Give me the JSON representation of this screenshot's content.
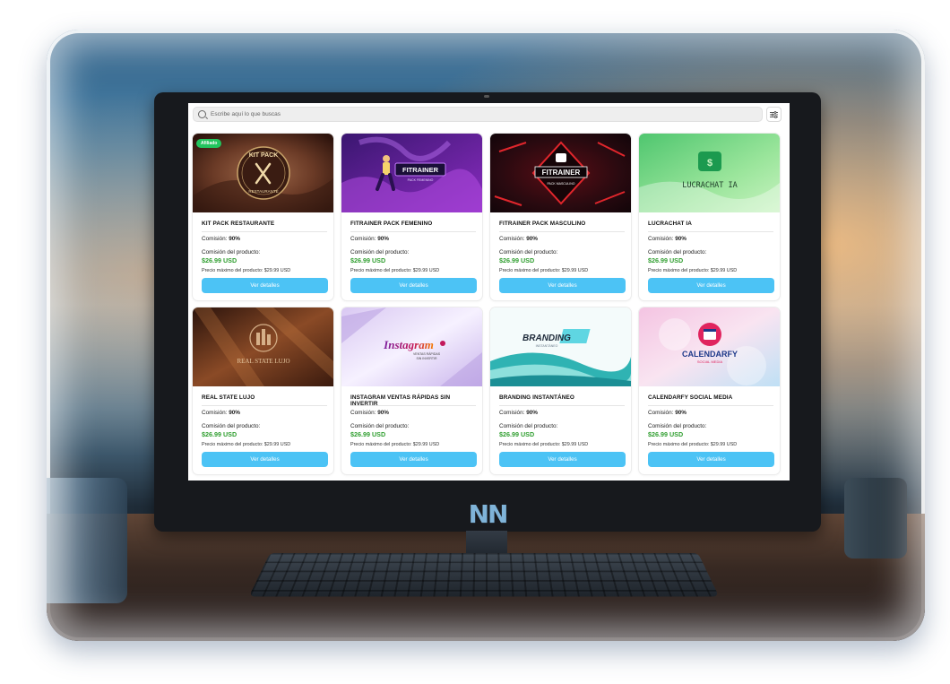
{
  "search": {
    "placeholder": "Escribe aquí lo que buscas"
  },
  "filter": {
    "icon": "sliders-icon"
  },
  "monitor": {
    "brand_logo": "NN"
  },
  "cards": [
    {
      "title": "KIT PACK RESTAURANTE",
      "badge": "Afiliado",
      "commission_label": "Comisión:",
      "commission": "90%",
      "price_label": "Comisión del producto:",
      "price": "$26.99 USD",
      "max_price": "Precio máximo del producto: $29.99 USD",
      "button": "Ver detalles",
      "thumb_lines": [
        "KIT PACK",
        "RESTAURANTE"
      ]
    },
    {
      "title": "FITRAINER PACK FEMENINO",
      "commission_label": "Comisión:",
      "commission": "90%",
      "price_label": "Comisión del producto:",
      "price": "$26.99 USD",
      "max_price": "Precio máximo del producto: $29.99 USD",
      "button": "Ver detalles",
      "thumb_lines": [
        "FITRAINER",
        "PACK FEMENINO"
      ]
    },
    {
      "title": "FITRAINER PACK MASCULINO",
      "commission_label": "Comisión:",
      "commission": "90%",
      "price_label": "Comisión del producto:",
      "price": "$26.99 USD",
      "max_price": "Precio máximo del producto: $29.99 USD",
      "button": "Ver detalles",
      "thumb_lines": [
        "FITRAINER",
        "PACK MASCULINO"
      ]
    },
    {
      "title": "LUCRACHAT IA",
      "commission_label": "Comisión:",
      "commission": "90%",
      "price_label": "Comisión del producto:",
      "price": "$26.99 USD",
      "max_price": "Precio máximo del producto: $29.99 USD",
      "button": "Ver detalles",
      "thumb_lines": [
        "LUCRACHAT IA"
      ]
    },
    {
      "title": "REAL STATE LUJO",
      "commission_label": "Comisión:",
      "commission": "90%",
      "price_label": "Comisión del producto:",
      "price": "$26.99 USD",
      "max_price": "Precio máximo del producto: $29.99 USD",
      "button": "Ver detalles",
      "thumb_lines": [
        "REAL STATE LUJO"
      ]
    },
    {
      "title": "INSTAGRAM VENTAS RÁPIDAS SIN INVERTIR",
      "commission_label": "Comisión:",
      "commission": "90%",
      "price_label": "Comisión del producto:",
      "price": "$26.99 USD",
      "max_price": "Precio máximo del producto: $29.99 USD",
      "button": "Ver detalles",
      "thumb_lines": [
        "Instagram",
        "VENTAS RÁPIDAS",
        "SIN INVERTIR"
      ]
    },
    {
      "title": "BRANDING INSTANTÁNEO",
      "commission_label": "Comisión:",
      "commission": "90%",
      "price_label": "Comisión del producto:",
      "price": "$26.99 USD",
      "max_price": "Precio máximo del producto: $29.99 USD",
      "button": "Ver detalles",
      "thumb_lines": [
        "BRANDING",
        "INSTANTÁNEO"
      ]
    },
    {
      "title": "CALENDARFY SOCIAL MEDIA",
      "commission_label": "Comisión:",
      "commission": "90%",
      "price_label": "Comisión del producto:",
      "price": "$26.99 USD",
      "max_price": "Precio máximo del producto: $29.99 USD",
      "button": "Ver detalles",
      "thumb_lines": [
        "CALENDARFY",
        "SOCIAL MEDIA"
      ]
    }
  ],
  "colors": {
    "accent_button": "#4cc3f5",
    "price_green": "#2f9e2f",
    "badge_green": "#22c55e"
  }
}
